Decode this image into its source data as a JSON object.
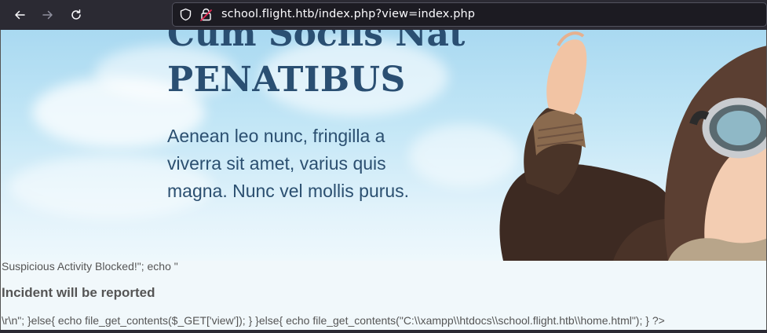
{
  "browser": {
    "url": "school.flight.htb/index.php?view=index.php",
    "icons": {
      "back": "arrow-left-icon",
      "forward": "arrow-right-icon",
      "reload": "reload-icon",
      "tracking": "shield-icon",
      "security": "lock-warning-icon"
    }
  },
  "hero": {
    "heading_cut": "Cum Sociis Nat",
    "heading": "PENATIBUS",
    "lead": "Aenean leo nunc, fringilla a viverra sit amet, varius quis magna. Nunc vel mollis purus."
  },
  "raw_output": {
    "line1": "Suspicious Activity Blocked!\"; echo \"",
    "incident": "Incident will be reported",
    "line3": "\\r\\n\"; }else{ echo file_get_contents($_GET['view']); } }else{ echo file_get_contents(\"C:\\\\xampp\\\\htdocs\\\\school.flight.htb\\\\home.html\"); } ?>"
  },
  "colors": {
    "chrome": "#2b2a33",
    "urlbar": "#1c1b22",
    "heading": "#2a4f72",
    "sky": "#a9d9f1"
  }
}
